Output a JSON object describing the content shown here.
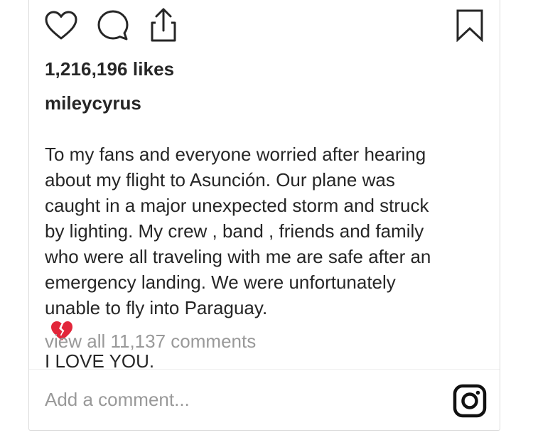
{
  "post": {
    "likes_text": "1,216,196 likes",
    "username": "mileycyrus",
    "caption_lines": [
      "To my fans and everyone worried after hearing",
      "about my flight to Asunción. Our plane was",
      "caught in a major unexpected storm and struck",
      "by lighting. My crew , band , friends and family",
      "who were all traveling with me are safe after an",
      "emergency landing. We were unfortunately"
    ],
    "caption_last_line_before_emoji": "unable to fly into Paraguay.",
    "caption_last_line_after_emoji": "I LOVE YOU.",
    "emoji": "broken-heart-emoji",
    "view_comments_text": "view all 11,137 comments"
  },
  "actions": {
    "like_icon": "heart-outline-icon",
    "comment_icon": "comment-bubble-icon",
    "share_icon": "share-upload-icon",
    "save_icon": "bookmark-icon"
  },
  "comment_box": {
    "placeholder": "Add a comment...",
    "camera_icon": "instagram-camera-icon"
  },
  "colors": {
    "text": "#262626",
    "secondary_text": "#999999",
    "border": "#dbdbdb",
    "broken_heart": "#e2263a"
  }
}
